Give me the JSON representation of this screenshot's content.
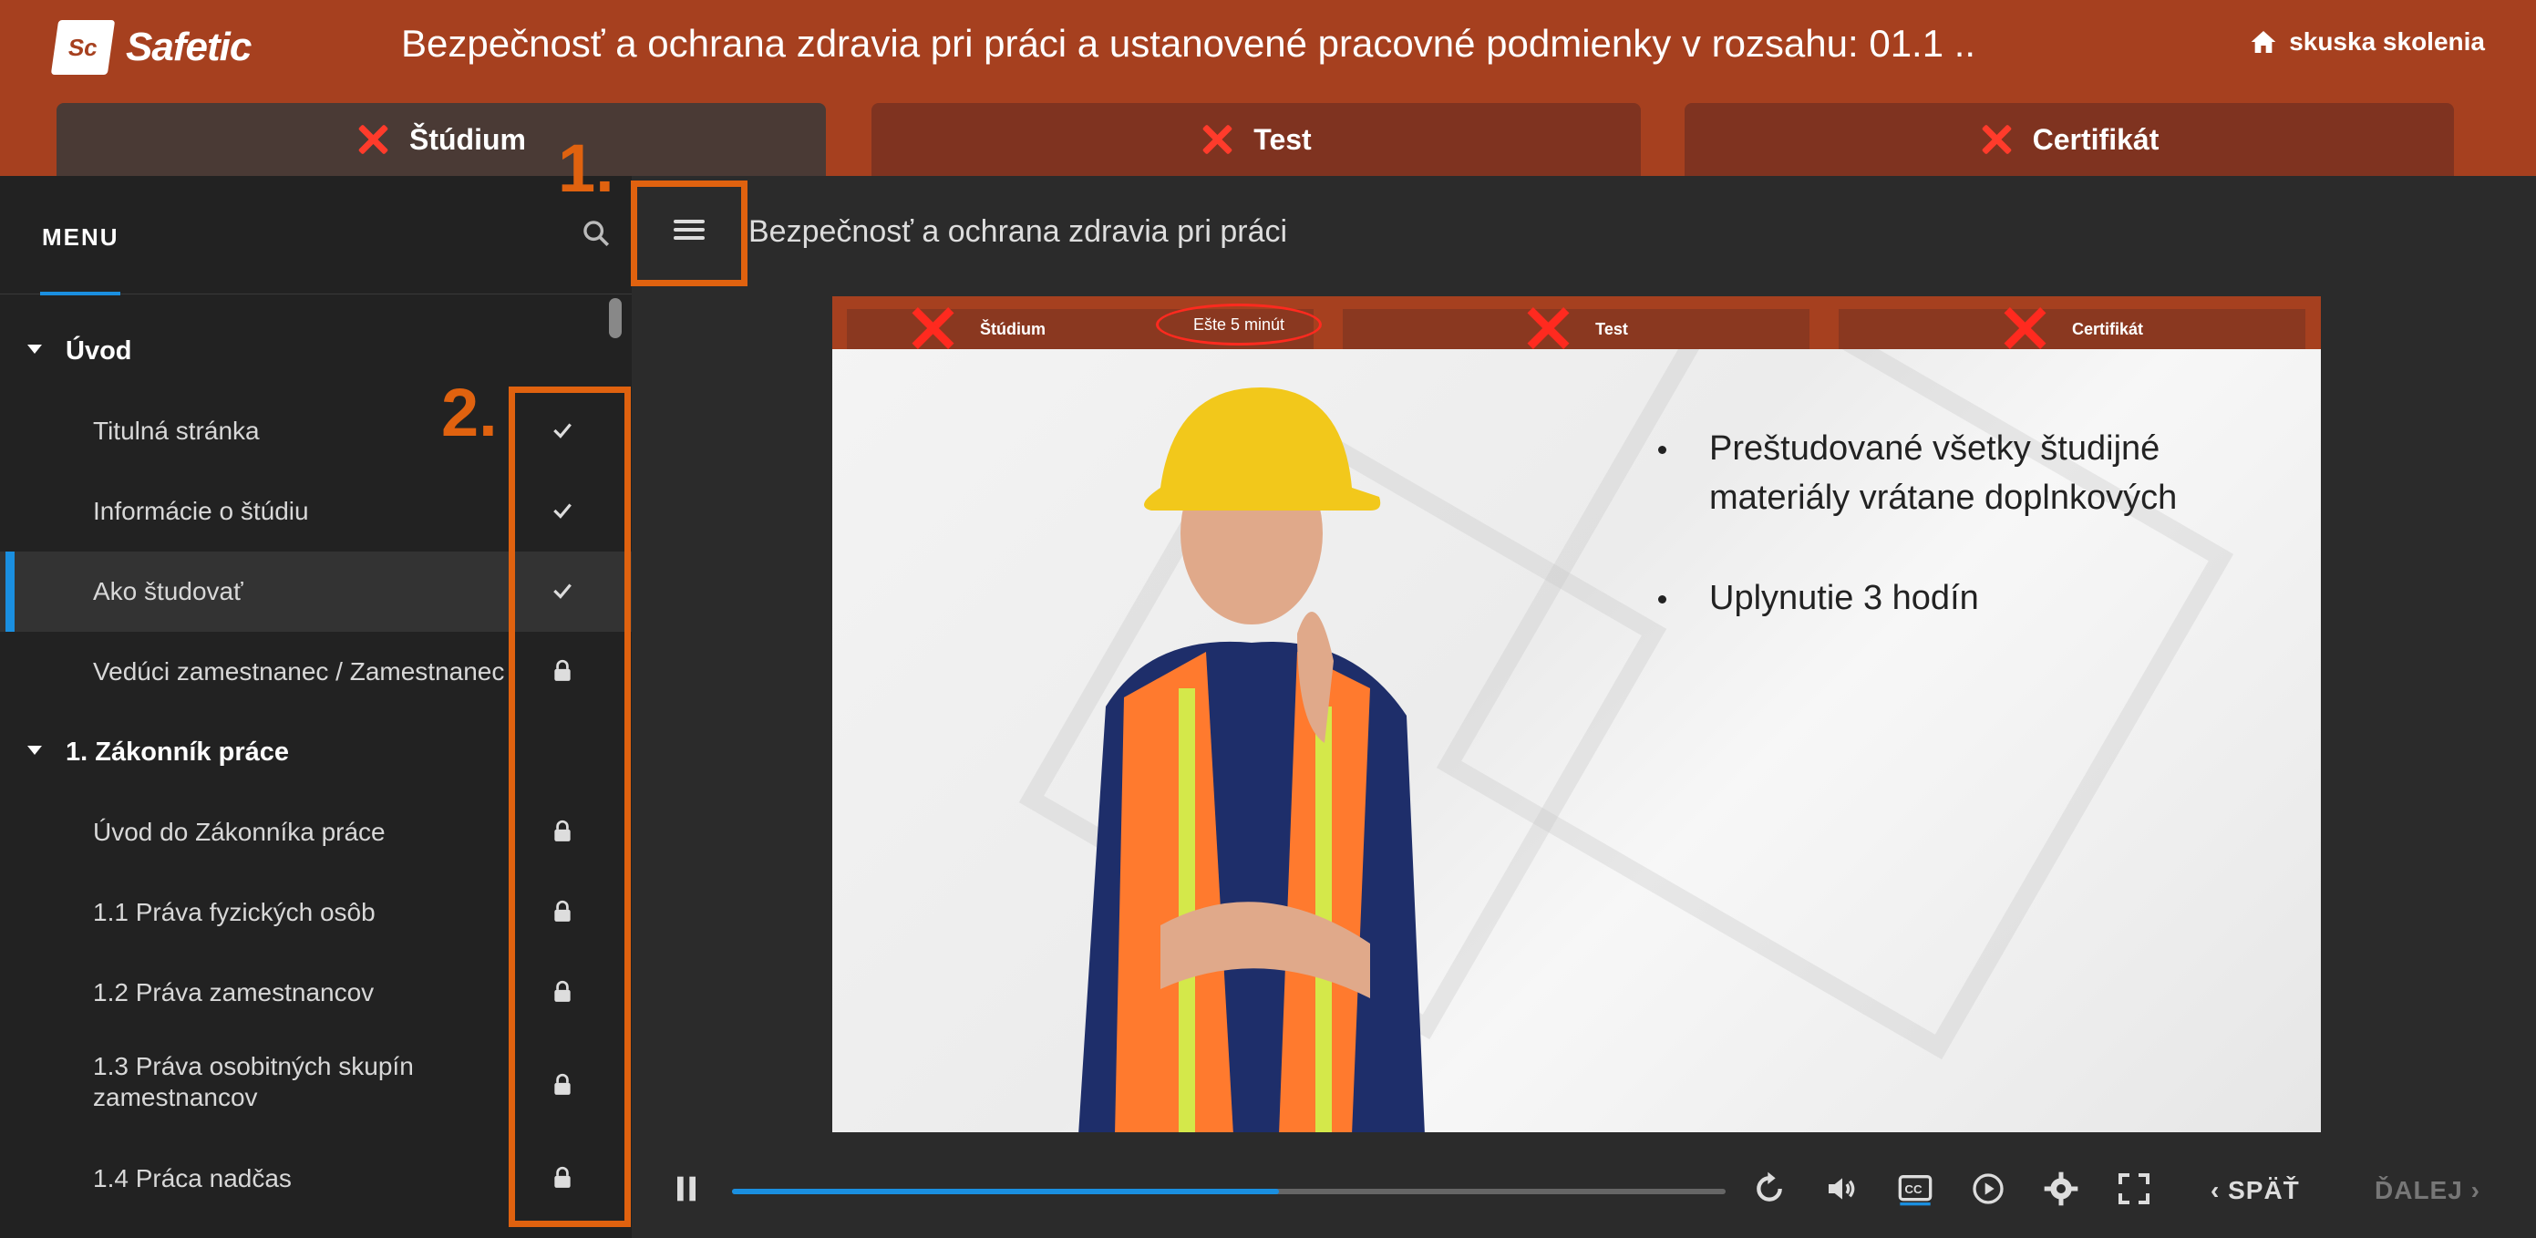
{
  "app": {
    "logo_badge": "Sc",
    "logo_text": "Safetic"
  },
  "header": {
    "course_title": "Bezpečnosť a ochrana zdravia pri práci a ustanovené pracovné podmienky v rozsahu: 01.1 ..",
    "home_label": "skuska skolenia"
  },
  "tabs": [
    {
      "label": "Štúdium",
      "status_icon": "red-x-icon",
      "active": true
    },
    {
      "label": "Test",
      "status_icon": "red-x-icon",
      "active": false
    },
    {
      "label": "Certifikát",
      "status_icon": "red-x-icon",
      "active": false
    }
  ],
  "sidebar": {
    "menu_label": "MENU",
    "sections": [
      {
        "title": "Úvod",
        "items": [
          {
            "label": "Titulná stránka",
            "status": "check"
          },
          {
            "label": "Informácie o štúdiu",
            "status": "check"
          },
          {
            "label": "Ako študovať",
            "status": "check",
            "active": true
          },
          {
            "label": "Vedúci zamestnanec / Zamestnanec",
            "status": "lock"
          }
        ]
      },
      {
        "title": "1. Zákonník práce",
        "items": [
          {
            "label": "Úvod do Zákonníka práce",
            "status": "lock"
          },
          {
            "label": "1.1 Práva fyzických osôb",
            "status": "lock"
          },
          {
            "label": "1.2 Práva zamestnancov",
            "status": "lock"
          },
          {
            "label": "1.3 Práva osobitných skupín zamestnancov",
            "status": "lock"
          },
          {
            "label": "1.4 Práca nadčas",
            "status": "lock"
          }
        ]
      }
    ]
  },
  "main": {
    "page_title": "Bezpečnosť a ochrana zdravia pri práci"
  },
  "slide": {
    "tabs": [
      "Štúdium",
      "Test",
      "Certifikát"
    ],
    "remaining": "Ešte 5 minút",
    "bullets": [
      "Preštudované všetky študijné materiály vrátane doplnkových",
      "Uplynutie 3 hodín"
    ]
  },
  "annotations": {
    "one": "1.",
    "two": "2."
  },
  "controls": {
    "progress": 0.55,
    "back_label": "SPÄŤ",
    "next_label": "ĎALEJ"
  },
  "colors": {
    "header": "#a6401f",
    "accent": "#1a8fe0",
    "annotation": "#e0620f",
    "error": "#ff3b2b"
  }
}
